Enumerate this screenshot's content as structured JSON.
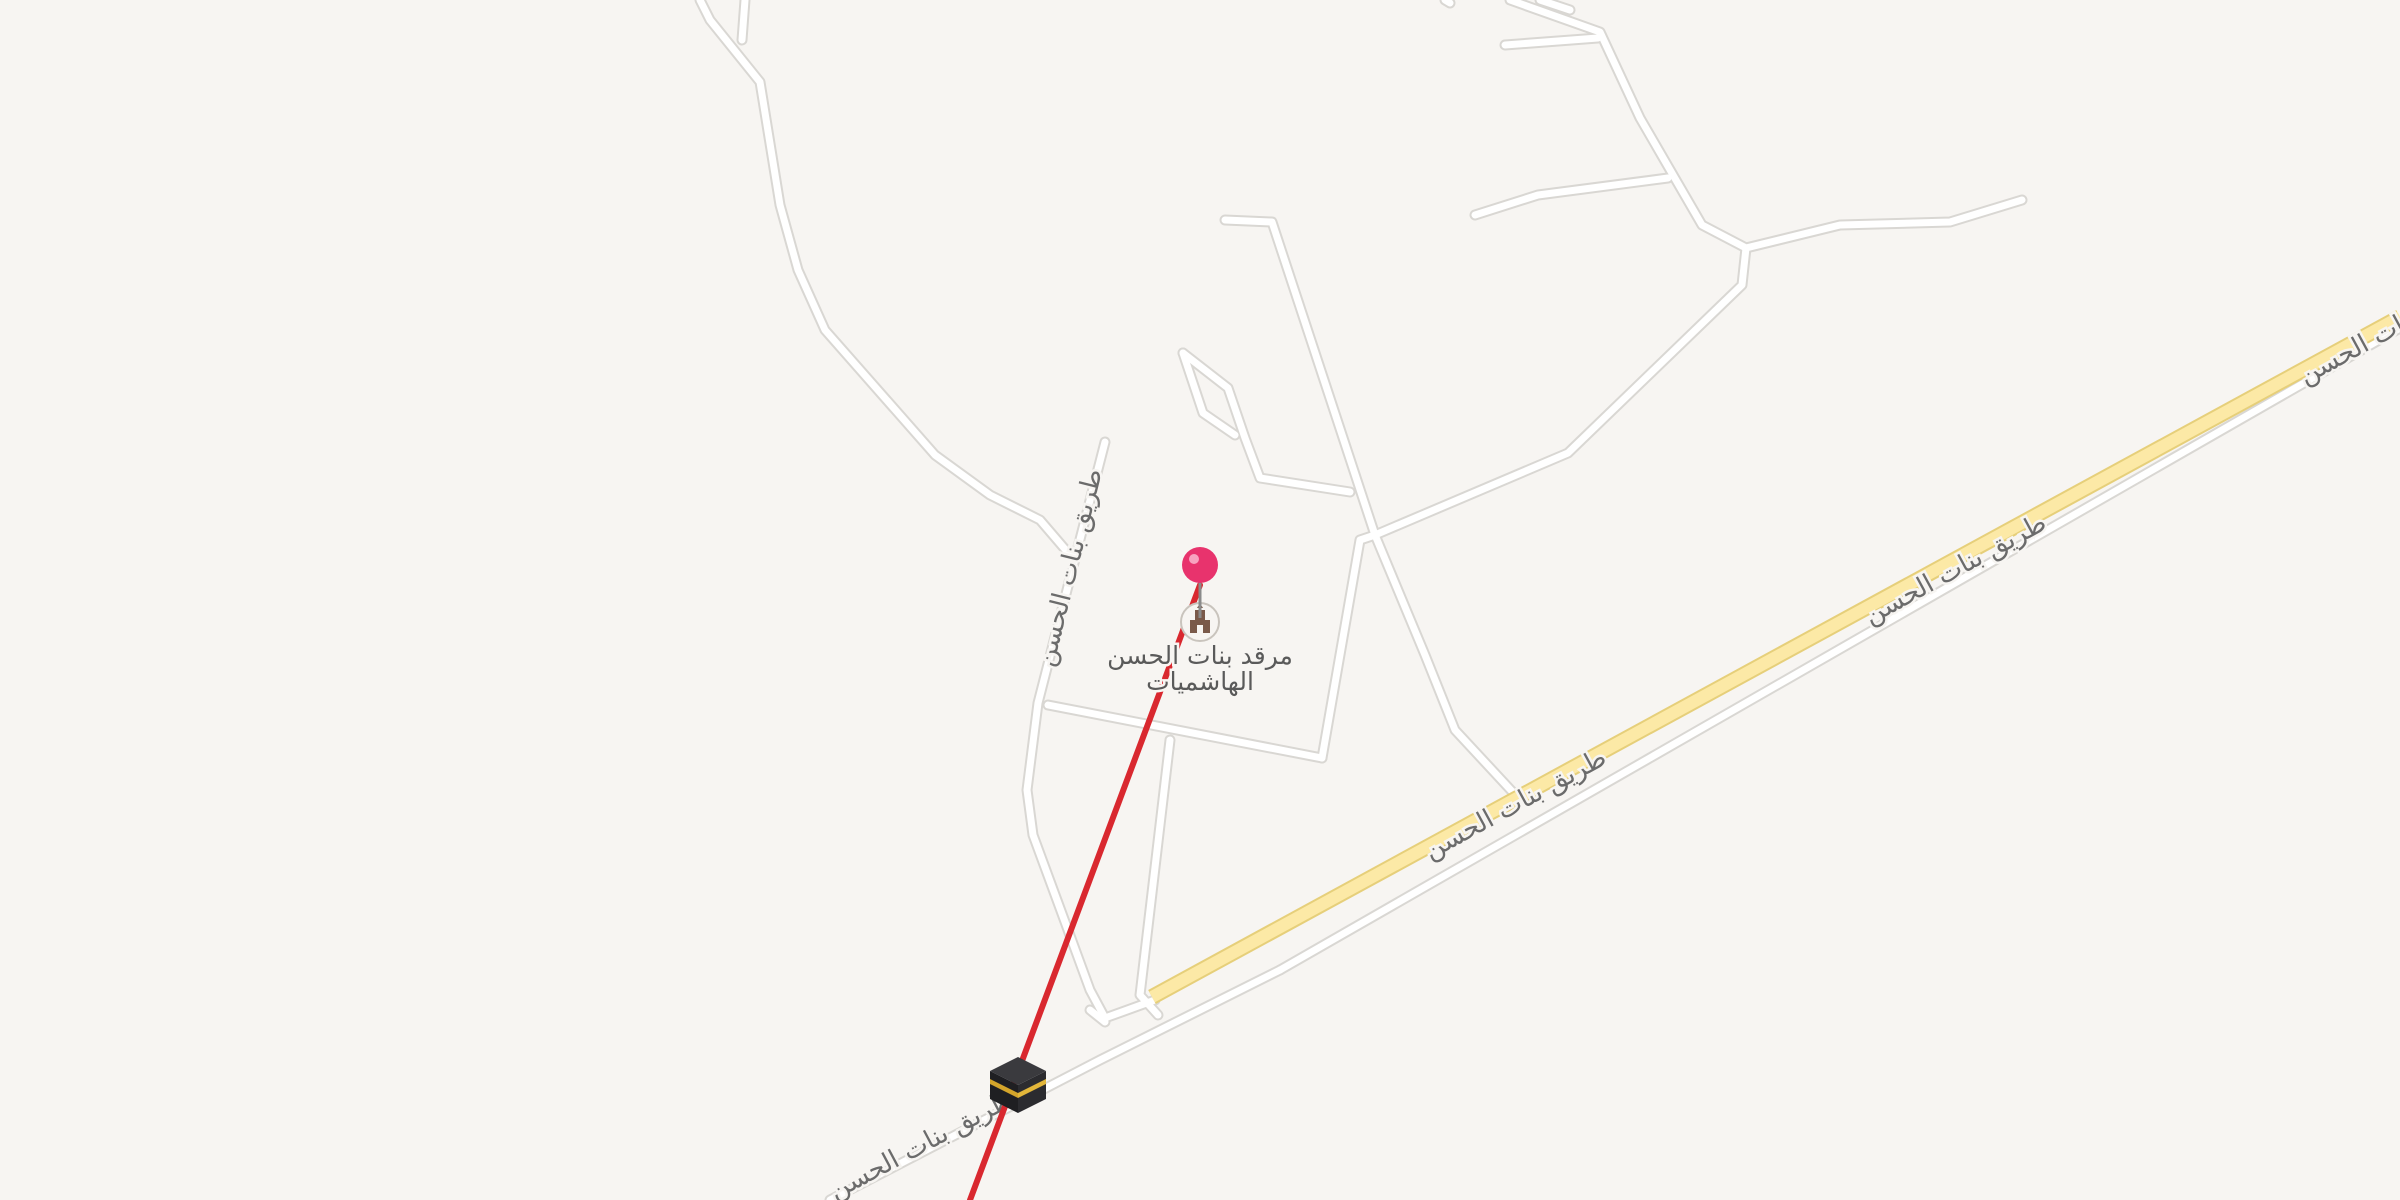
{
  "map": {
    "background_color": "#f7f5f2",
    "road_color": "#ffffff",
    "road_outline_color": "#d9d7d3",
    "major_road_color": "#fce9a6",
    "major_road_outline_color": "#e6cf7a",
    "route_line_color": "#d9282f",
    "pin_color": "#e8336d"
  },
  "labels": {
    "road_main": "طريق بنات الحسن",
    "road_side": "طريق بنات الحسن",
    "poi_line1": "مرقد بنات الحسن",
    "poi_line2": "الهاشميات"
  },
  "markers": {
    "destination_pin": "map-pin",
    "poi_icon": "shrine-icon",
    "origin_icon": "kaaba-icon"
  }
}
